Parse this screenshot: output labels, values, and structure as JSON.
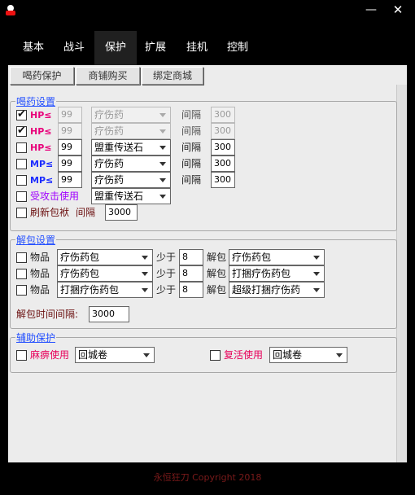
{
  "window": {
    "minimize": "—",
    "close": "✕"
  },
  "tabs": [
    {
      "label": "基本"
    },
    {
      "label": "战斗"
    },
    {
      "label": "保护"
    },
    {
      "label": "扩展"
    },
    {
      "label": "挂机"
    },
    {
      "label": "控制"
    }
  ],
  "subtabs": [
    {
      "label": "喝药保护"
    },
    {
      "label": "商铺购买"
    },
    {
      "label": "绑定商城"
    }
  ],
  "potion": {
    "title": "喝药设置",
    "interval_label": "间隔",
    "rows": [
      {
        "type": "HP",
        "symbol": "HP≤",
        "checked": true,
        "value": "99",
        "item": "疗伤药",
        "interval": "300",
        "disabled": true
      },
      {
        "type": "HP",
        "symbol": "HP≤",
        "checked": true,
        "value": "99",
        "item": "疗伤药",
        "interval": "300",
        "disabled": true
      },
      {
        "type": "HP",
        "symbol": "HP≤",
        "checked": false,
        "value": "99",
        "item": "盟重传送石",
        "interval": "300",
        "disabled": false
      },
      {
        "type": "MP",
        "symbol": "MP≤",
        "checked": false,
        "value": "99",
        "item": "疗伤药",
        "interval": "300",
        "disabled": false
      },
      {
        "type": "MP",
        "symbol": "MP≤",
        "checked": false,
        "value": "99",
        "item": "疗伤药",
        "interval": "300",
        "disabled": false
      }
    ],
    "attacked": {
      "label": "受攻击使用",
      "item": "盟重传送石",
      "checked": false
    },
    "refresh": {
      "label": "刷新包袱",
      "interval_label": "间隔",
      "value": "3000",
      "checked": false
    }
  },
  "unpack": {
    "title": "解包设置",
    "item_label": "物品",
    "less_label": "少于",
    "unpack_label": "解包",
    "rows": [
      {
        "item": "疗伤药包",
        "count": "8",
        "target": "疗伤药包"
      },
      {
        "item": "疗伤药包",
        "count": "8",
        "target": "打捆疗伤药包"
      },
      {
        "item": "打捆疗伤药包",
        "count": "8",
        "target": "超级打捆疗伤药"
      }
    ],
    "interval_label": "解包时间间隔:",
    "interval_value": "3000"
  },
  "assist": {
    "title": "辅助保护",
    "paralysis": {
      "label": "麻痹使用",
      "item": "回城卷"
    },
    "revive": {
      "label": "复活使用",
      "item": "回城卷"
    }
  },
  "footer": {
    "text": "永恒狂刀  Copyright 2018"
  }
}
